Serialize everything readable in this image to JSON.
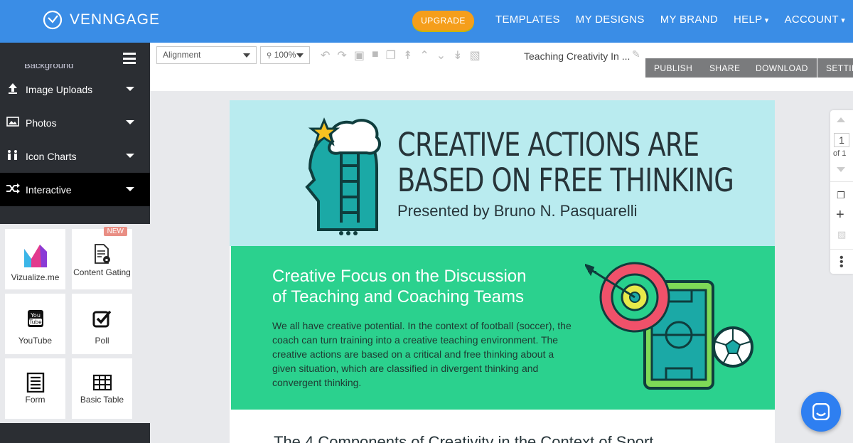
{
  "brand": {
    "name": "VENNGAGE"
  },
  "nav": {
    "upgrade": "UPGRADE",
    "links": [
      "TEMPLATES",
      "MY DESIGNS",
      "MY BRAND",
      "HELP",
      "ACCOUNT"
    ]
  },
  "sidebar": {
    "cut_item": "Background",
    "items": [
      {
        "label": "Image Uploads",
        "icon": "upload-icon"
      },
      {
        "label": "Photos",
        "icon": "photo-icon"
      },
      {
        "label": "Icon Charts",
        "icon": "people-chart-icon"
      },
      {
        "label": "Interactive",
        "icon": "shuffle-icon"
      }
    ],
    "tiles": [
      {
        "label": "Vizualize.me",
        "icon": "vizualize-logo"
      },
      {
        "label": "Content Gating",
        "icon": "document-lock-icon",
        "badge": "NEW"
      },
      {
        "label": "YouTube",
        "icon": "youtube-icon"
      },
      {
        "label": "Poll",
        "icon": "poll-check-icon"
      },
      {
        "label": "Form",
        "icon": "form-list-icon"
      },
      {
        "label": "Basic Table",
        "icon": "table-grid-icon"
      }
    ]
  },
  "toolbar": {
    "alignment": "Alignment",
    "zoom": "100%",
    "doc_title": "Teaching Creativity In ...",
    "actions": [
      "PUBLISH",
      "SHARE",
      "DOWNLOAD",
      "SETTIN"
    ]
  },
  "canvas": {
    "headline_1": "CREATIVE ACTIONS ARE",
    "headline_2": "BASED ON FREE THINKING",
    "presenter": "Presented by Bruno N. Pasquarelli",
    "sub_1": "Creative Focus on the Discussion",
    "sub_2": "of Teaching and Coaching Teams",
    "paragraph": "We all have creative potential. In the context of football (soccer), the coach can turn training into a creative teaching environment. The creative actions are based on a critical and free thinking about a given situation, which are classified in divergent thinking and convergent thinking.",
    "section3": "The 4 Components of Creativity in the Context of Sport"
  },
  "pages": {
    "current": "1",
    "total": "of 1"
  },
  "colors": {
    "nav": "#3a8de6",
    "sidebar": "#2b2e33",
    "upgrade": "#f59e1b",
    "hero": "#b9ebef",
    "green": "#2bd18e"
  }
}
